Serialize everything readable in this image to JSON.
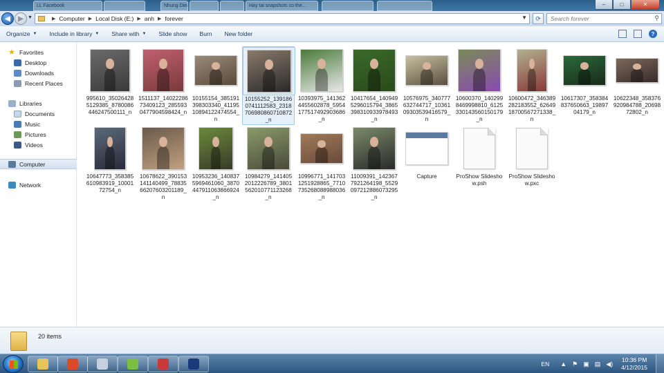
{
  "window": {
    "ghost_tabs": [
      " LL Facebook",
      "",
      "Nhung Diem dinh Viem...",
      "",
      "",
      "Hay tai snapshots co the...",
      "",
      ""
    ],
    "controls": {
      "minimize": "–",
      "maximize": "□",
      "close": "✕"
    }
  },
  "address_bar": {
    "crumbs": [
      "Computer",
      "Local Disk (E:)",
      "anh",
      "forever"
    ],
    "search_placeholder": "Search forever"
  },
  "toolbar": {
    "items": [
      "Organize",
      "Include in library",
      "Share with",
      "Slide show",
      "Burn",
      "New folder"
    ]
  },
  "nav": {
    "favorites": "Favorites",
    "desktop": "Desktop",
    "downloads": "Downloads",
    "recent": "Recent Places",
    "libraries": "Libraries",
    "documents": "Documents",
    "music": "Music",
    "pictures": "Pictures",
    "videos": "Videos",
    "computer": "Computer",
    "network": "Network"
  },
  "files": [
    {
      "name": "995610_350264285129385_8780086446247500111_n",
      "kind": "photo",
      "palette": [
        "#6b6b6b",
        "#3a3a3a"
      ]
    },
    {
      "name": "1511137_1402228673409123_2855930477904598424_n",
      "kind": "photo",
      "palette": [
        "#c06070",
        "#7a3a3a"
      ]
    },
    {
      "name": "10155154_385191398303340_4119510894122474554_n",
      "kind": "photo",
      "palette": [
        "#9a8a7a",
        "#5a4a3a"
      ]
    },
    {
      "name": "10155252_1391860741112583_2318706980860710872_n",
      "kind": "photo",
      "palette": [
        "#8a7a6a",
        "#2a2a2a"
      ]
    },
    {
      "name": "10393975_1413624455602878_5954177517492903686_n",
      "kind": "photo",
      "palette": [
        "#4a7a3a",
        "#e8e8e8"
      ]
    },
    {
      "name": "10417654_1409495296015794_3865398310933978493_n",
      "kind": "photo",
      "palette": [
        "#3a6a2a",
        "#2a4a1a"
      ]
    },
    {
      "name": "10576975_340777632744717_1036109303539416579_n",
      "kind": "photo",
      "palette": [
        "#c8c0a0",
        "#5a5040"
      ]
    },
    {
      "name": "10600370_1402998469998810_6125330143560150179_n",
      "kind": "photo",
      "palette": [
        "#7a8a5a",
        "#8a4ab0"
      ]
    },
    {
      "name": "10600472_346389282183552_6264918700567271338_n",
      "kind": "photo",
      "palette": [
        "#b0b090",
        "#8a3a3a"
      ]
    },
    {
      "name": "10617307_358384837650663_1989704179_n",
      "kind": "photo",
      "palette": [
        "#2a6a3a",
        "#1a2a1a"
      ]
    },
    {
      "name": "10622348_358376920984788_2069872802_n",
      "kind": "photo",
      "palette": [
        "#7a6a5a",
        "#3a2a2a"
      ]
    },
    {
      "name": "10647773_358385610983919_1000172754_n",
      "kind": "photo",
      "palette": [
        "#5a6a7a",
        "#2a2a3a"
      ]
    },
    {
      "name": "10678622_390153141140499_7883566207603201189_n",
      "kind": "photo",
      "palette": [
        "#6a5a4a",
        "#c0a080"
      ]
    },
    {
      "name": "10953236_1408375969461060_3870447911063866924_n",
      "kind": "photo",
      "palette": [
        "#6a8a3a",
        "#3a3a2a"
      ]
    },
    {
      "name": "10984279_1414052012226789_3801562010771123268_n",
      "kind": "photo",
      "palette": [
        "#8a9a6a",
        "#4a4a3a"
      ]
    },
    {
      "name": "10996771_1417031251928865_7710735268088988036_n",
      "kind": "photo",
      "palette": [
        "#a07a5a",
        "#6a4a3a"
      ]
    },
    {
      "name": "11009391_1423677921264198_5529097212886073295_n",
      "kind": "photo",
      "palette": [
        "#7a8a6a",
        "#2a2a2a"
      ]
    },
    {
      "name": "Capture",
      "kind": "screenshot",
      "palette": [
        "#f2f2f2",
        "#5a7aa0"
      ]
    },
    {
      "name": "ProShow Slideshow.psh",
      "kind": "document",
      "palette": [
        "#fafafa",
        "#c8c8c8"
      ]
    },
    {
      "name": "ProShow Slideshow.pxc",
      "kind": "document",
      "palette": [
        "#fafafa",
        "#c8c8c8"
      ]
    }
  ],
  "selected_file": "10155252_1391860741112583_2318706980860710872_n",
  "details": {
    "item_count": "20 items"
  },
  "taskbar": {
    "apps": [
      "explorer-icon",
      "media-player-icon",
      "paint-icon",
      "coccoc-browser-icon",
      "game-icon",
      "lol-icon"
    ],
    "language": "EN",
    "time": "10:36 PM",
    "date": "4/12/2015"
  }
}
